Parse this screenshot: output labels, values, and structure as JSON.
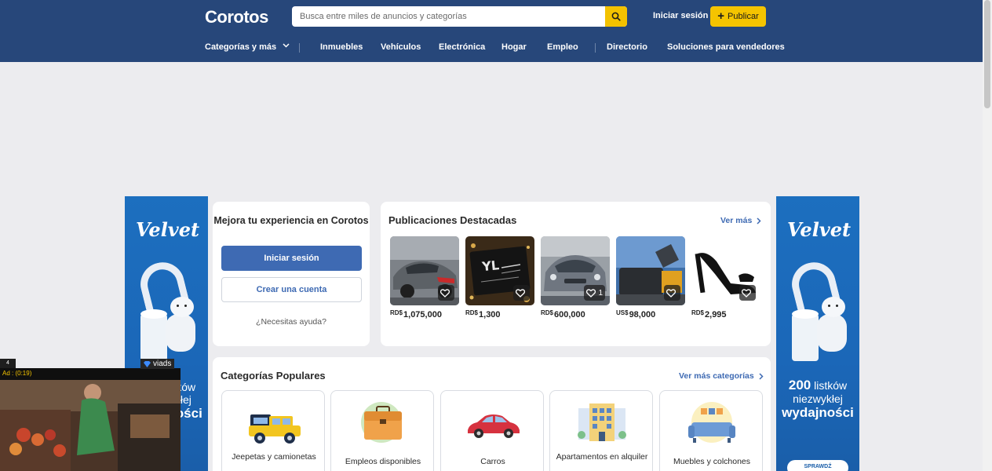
{
  "header": {
    "logo": "Corotos",
    "search_placeholder": "Busca entre miles de anuncios y categorías",
    "login": "Iniciar sesión",
    "publish": "Publicar",
    "nav": {
      "categories": "Categorías y más",
      "real_estate": "Inmuebles",
      "vehicles": "Vehículos",
      "electronics": "Electrónica",
      "home": "Hogar",
      "jobs": "Empleo",
      "directory": "Directorio",
      "sellers": "Soluciones para vendedores"
    }
  },
  "login_card": {
    "title": "Mejora tu experiencia en Corotos",
    "login_button": "Iniciar sesión",
    "create_account": "Crear una cuenta",
    "help": "¿Necesitas ayuda?"
  },
  "featured": {
    "title": "Publicaciones Destacadas",
    "see_more": "Ver más",
    "items": [
      {
        "currency": "RD$",
        "price": "1,075,000",
        "fav_count": ""
      },
      {
        "currency": "RD$",
        "price": "1,300",
        "fav_count": ""
      },
      {
        "currency": "RD$",
        "price": "600,000",
        "fav_count": "1"
      },
      {
        "currency": "US$",
        "price": "98,000",
        "fav_count": ""
      },
      {
        "currency": "RD$",
        "price": "2,995",
        "fav_count": ""
      }
    ]
  },
  "popular": {
    "title": "Categorías Populares",
    "see_more": "Ver más categorías",
    "items": [
      {
        "label": "Jeepetas y camionetas"
      },
      {
        "label": "Empleos disponibles"
      },
      {
        "label": "Carros"
      },
      {
        "label": "Apartamentos en alquiler"
      },
      {
        "label": "Muebles y colchones"
      }
    ]
  },
  "side_ads": {
    "brand": "Velvet",
    "line_number": "200",
    "line_word": "listków",
    "line_2": "niezwykłej",
    "line_3": "wydajności",
    "cta": "SPRAWDŹ"
  },
  "video_ad": {
    "badge": "4",
    "timer": "Ad : (0:19)",
    "brand": "viads"
  },
  "colors": {
    "header_bg": "#27477a",
    "accent_yellow": "#f5c400",
    "primary_blue": "#3e6ab3"
  }
}
